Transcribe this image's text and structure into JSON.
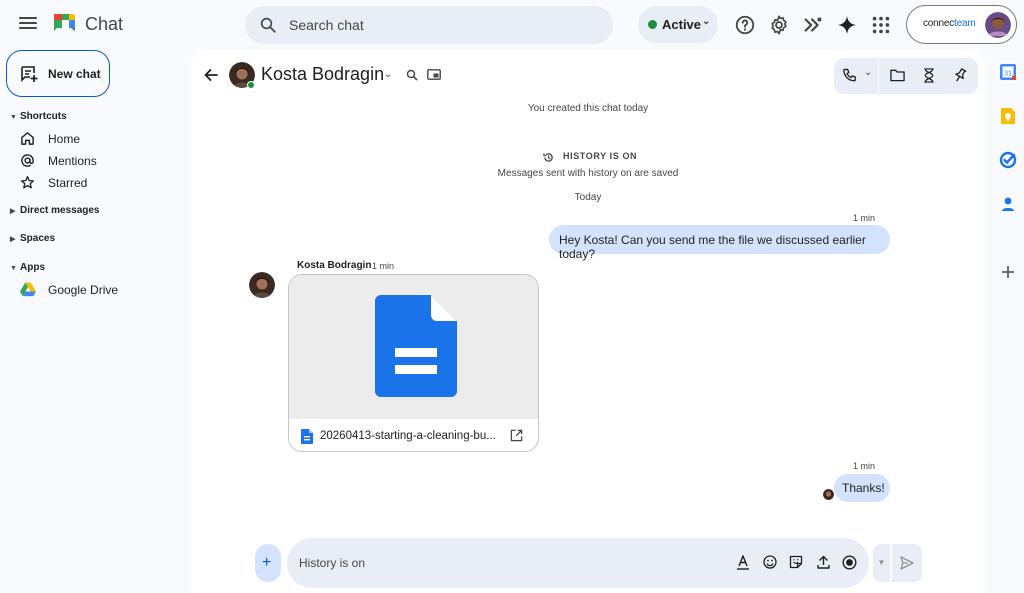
{
  "app": {
    "name": "Chat"
  },
  "search": {
    "placeholder": "Search chat"
  },
  "status": {
    "label": "Active",
    "color": "#1e8e3e"
  },
  "account": {
    "org_prefix": "connec",
    "org_suffix": "team"
  },
  "topbar_icons": [
    "help-icon",
    "settings-icon",
    "apps-shortcut-icon",
    "gemini-icon",
    "google-apps-icon"
  ],
  "sidebar": {
    "new_chat": "New chat",
    "sections": {
      "shortcuts": "Shortcuts",
      "direct_messages": "Direct messages",
      "spaces": "Spaces",
      "apps": "Apps"
    },
    "shortcuts": [
      {
        "label": "Home",
        "icon": "home-icon"
      },
      {
        "label": "Mentions",
        "icon": "at-icon"
      },
      {
        "label": "Starred",
        "icon": "star-icon"
      }
    ],
    "apps": [
      {
        "label": "Google Drive",
        "icon": "google-drive-icon"
      }
    ]
  },
  "conversation": {
    "contact_name": "Kosta Bodragin",
    "created_notice": "You created this chat today",
    "history_title": "HISTORY IS ON",
    "history_subtitle": "Messages sent with history on are saved",
    "date_divider": "Today",
    "messages": [
      {
        "from": "me",
        "time": "1 min",
        "text": "Hey Kosta! Can you send me the file we discussed earlier today?"
      },
      {
        "from": "Kosta Bodragin",
        "time": "1 min",
        "attachment": {
          "name": "20260413-starting-a-cleaning-bu...",
          "type": "google-docs"
        }
      },
      {
        "from": "me",
        "time": "1 min",
        "text": "Thanks!"
      }
    ]
  },
  "composer": {
    "placeholder": "History is on"
  },
  "colors": {
    "accent": "#0b57d0",
    "bubble": "#d3e3fd",
    "surface": "#e9eef6",
    "docs_blue": "#1a73e8"
  }
}
